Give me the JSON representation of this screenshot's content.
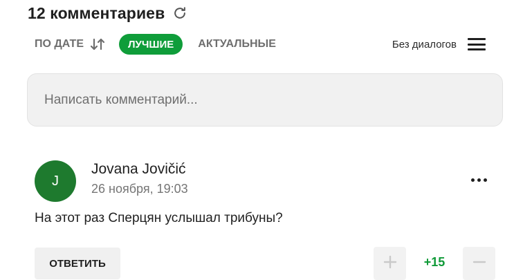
{
  "header": {
    "title": "12 комментариев",
    "refresh_icon": "refresh-icon"
  },
  "sort": {
    "by_date": "ПО ДАТЕ",
    "by_date_icon": "sort-arrows-icon",
    "best": "ЛУЧШИЕ",
    "actual": "АКТУАЛЬНЫЕ",
    "active": "best",
    "dialogs_label": "Без диалогов",
    "menu_icon": "hamburger-menu-icon"
  },
  "composer": {
    "placeholder": "Написать комментарий..."
  },
  "comment": {
    "avatar_letter": "J",
    "author": "Jovana Jovičić",
    "timestamp": "26 ноября, 19:03",
    "text": "На этот раз Сперцян услышал трибуны?",
    "reply_label": "ОТВЕТИТЬ",
    "score": "+15",
    "more_icon": "more-dots-icon",
    "upvote_icon": "plus-icon",
    "downvote_icon": "minus-icon"
  },
  "colors": {
    "accent_green": "#0f9d3a",
    "avatar_green": "#1e7a2e",
    "score_green": "#109a38"
  }
}
